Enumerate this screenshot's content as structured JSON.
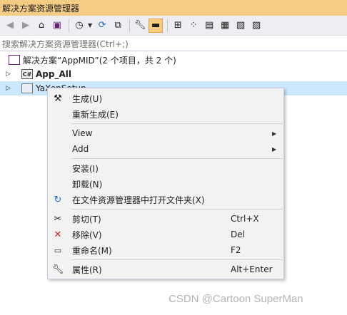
{
  "window": {
    "title": "解决方案资源管理器"
  },
  "toolbar": {
    "icons": [
      "back-icon",
      "forward-icon",
      "home-icon",
      "vs-icon",
      "history-icon",
      "sync-icon",
      "collapse-icon",
      "wrench-icon",
      "preview-icon",
      "pin-icon",
      "class-view-icon",
      "properties-icon",
      "files-icon",
      "show-all-icon",
      "filter-icon"
    ]
  },
  "search": {
    "placeholder": "搜索解决方案资源管理器(Ctrl+;)"
  },
  "tree": {
    "solution_label": "解决方案“AppMID”(2 个项目，共 2 个)",
    "project1": "App_All",
    "project2": "YaXenSetup"
  },
  "menu": {
    "build": {
      "label": "生成(U)"
    },
    "rebuild": {
      "label": "重新生成(E)"
    },
    "view": {
      "label": "View"
    },
    "add": {
      "label": "Add"
    },
    "install": {
      "label": "安装(I)"
    },
    "uninstall": {
      "label": "卸载(N)"
    },
    "open_folder": {
      "label": "在文件资源管理器中打开文件夹(X)"
    },
    "cut": {
      "label": "剪切(T)",
      "shortcut": "Ctrl+X"
    },
    "remove": {
      "label": "移除(V)",
      "shortcut": "Del"
    },
    "rename": {
      "label": "重命名(M)",
      "shortcut": "F2"
    },
    "properties": {
      "label": "属性(R)",
      "shortcut": "Alt+Enter"
    }
  },
  "watermark": "CSDN @Cartoon SuperMan",
  "colors": {
    "titlebar": "#f5cc84",
    "selection": "#cce8ff",
    "remove_icon": "#d02020",
    "refresh_icon": "#1e6cc8"
  }
}
